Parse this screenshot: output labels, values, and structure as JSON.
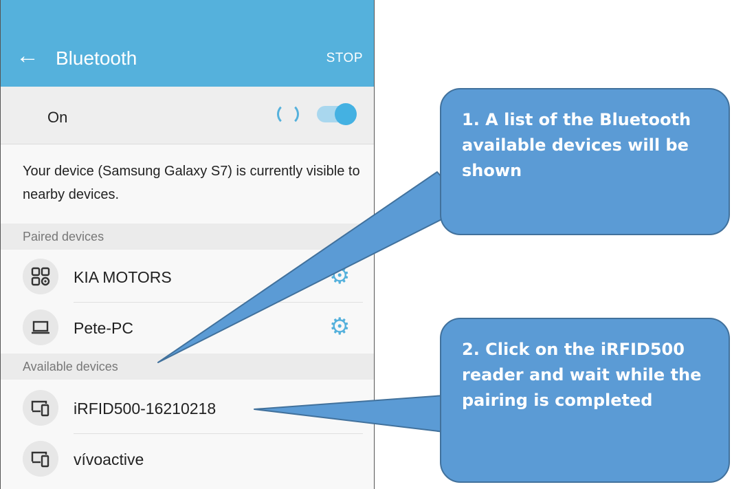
{
  "header": {
    "back_icon": "arrow-left-icon",
    "title": "Bluetooth",
    "stop_label": "STOP"
  },
  "toggle_row": {
    "label": "On",
    "state": "on"
  },
  "visibility_text": "Your device (Samsung Galaxy S7) is currently visible to nearby devices.",
  "paired": {
    "header": "Paired devices",
    "items": [
      {
        "name": "KIA MOTORS",
        "icon": "car-audio-icon",
        "settings_icon": "gear-icon"
      },
      {
        "name": "Pete-PC",
        "icon": "laptop-icon",
        "settings_icon": "gear-icon"
      }
    ]
  },
  "available": {
    "header": "Available devices",
    "items": [
      {
        "name": "iRFID500-16210218",
        "icon": "devices-icon"
      },
      {
        "name": "vívoactive",
        "icon": "devices-icon"
      }
    ]
  },
  "callouts": {
    "c1": {
      "text": "1. A list of the Bluetooth available devices will be shown"
    },
    "c2": {
      "text": "2. Click on the iRFID500 reader and wait while the pairing is completed"
    }
  },
  "colors": {
    "accent": "#55b1dc",
    "callout_fill": "#5b9bd5",
    "callout_border": "#41719c"
  }
}
